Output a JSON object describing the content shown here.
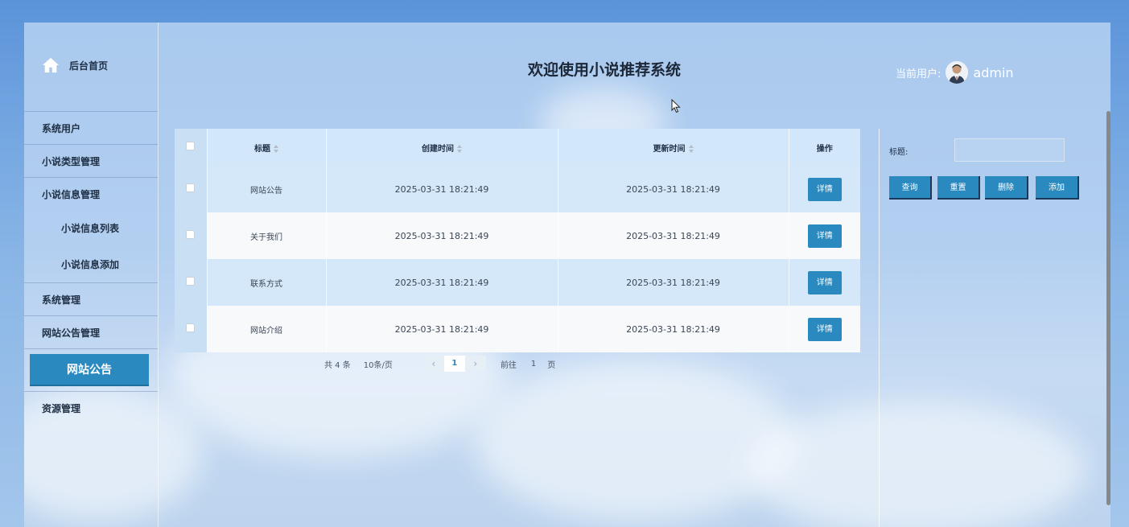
{
  "header": {
    "title": "欢迎使用小说推荐系统",
    "user_label": "当前用户:",
    "username": "admin"
  },
  "sidebar": {
    "home_label": "后台首页",
    "items": [
      "系统用户",
      "小说类型管理",
      "小说信息管理",
      "小说信息列表",
      "小说信息添加",
      "系统管理",
      "网站公告管理",
      "网站公告",
      "资源管理"
    ]
  },
  "table": {
    "columns": [
      "标题",
      "创建时间",
      "更新时间",
      "操作"
    ],
    "rows": [
      {
        "title": "网站公告",
        "created": "2025-03-31 18:21:49",
        "updated": "2025-03-31 18:21:49",
        "action": "详情"
      },
      {
        "title": "关于我们",
        "created": "2025-03-31 18:21:49",
        "updated": "2025-03-31 18:21:49",
        "action": "详情"
      },
      {
        "title": "联系方式",
        "created": "2025-03-31 18:21:49",
        "updated": "2025-03-31 18:21:49",
        "action": "详情"
      },
      {
        "title": "网站介绍",
        "created": "2025-03-31 18:21:49",
        "updated": "2025-03-31 18:21:49",
        "action": "详情"
      }
    ]
  },
  "pagination": {
    "total": "共 4 条",
    "page_size": "10条/页",
    "prev": "‹",
    "current": "1",
    "next": "›",
    "goto_prefix": "前往",
    "goto_value": "1",
    "goto_suffix": "页"
  },
  "search": {
    "label": "标题:",
    "value": ""
  },
  "actions": {
    "query": "查询",
    "reset": "重置",
    "delete": "删除",
    "add": "添加"
  },
  "colors": {
    "accent": "#2a8ac0",
    "page_bg": "#5b93d9"
  }
}
